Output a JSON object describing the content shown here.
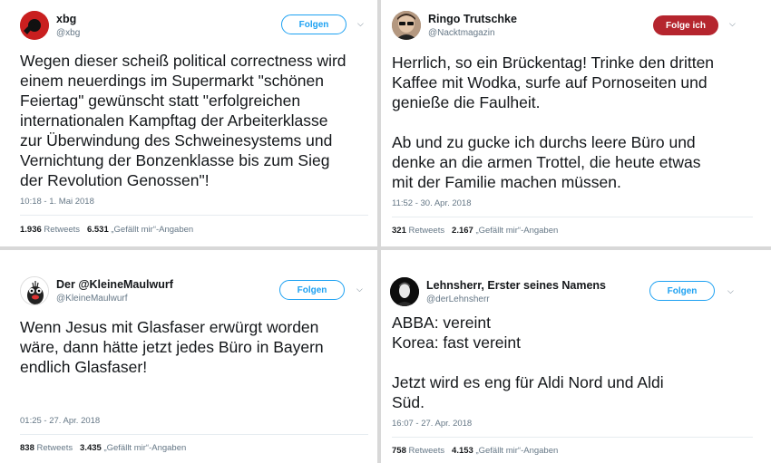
{
  "tweets": [
    {
      "name": "xbg",
      "handle": "@xbg",
      "follow": "Folgen",
      "text": [
        "Wegen dieser scheiß political correctness wird",
        "einem neuerdings im Supermarkt \"schönen",
        "Feiertag\" gewünscht statt \"erfolgreichen",
        "internationalen Kampftag der Arbeiterklasse",
        "zur Überwindung des Schweinesystems  und",
        "Vernichtung der Bonzenklasse bis zum Sieg",
        "der Revolution Genossen\"!"
      ],
      "time": "10:18 - 1. Mai 2018",
      "retweets": "1.936",
      "retweets_label": "Retweets",
      "likes": "6.531",
      "likes_label": "„Gefällt mir“-Angaben"
    },
    {
      "name": "Ringo Trutschke",
      "handle": "@Nacktmagazin",
      "follow": "Folge ich",
      "text1": [
        "Herrlich, so ein Brückentag! Trinke den dritten",
        "Kaffee mit Wodka, surfe auf Pornoseiten und",
        "genieße die Faulheit."
      ],
      "text2": [
        "Ab und zu gucke ich durchs leere Büro und",
        "denke an die armen Trottel, die heute etwas",
        "mit der Familie machen müssen."
      ],
      "time": "11:52 - 30. Apr. 2018",
      "retweets": "321",
      "retweets_label": "Retweets",
      "likes": "2.167",
      "likes_label": "„Gefällt mir“-Angaben"
    },
    {
      "name": "Der @KleineMaulwurf",
      "handle": "@KleineMaulwurf",
      "follow": "Folgen",
      "text": [
        "Wenn Jesus mit Glasfaser erwürgt worden",
        "wäre, dann hätte jetzt jedes Büro in Bayern",
        "endlich Glasfaser!"
      ],
      "time": "01:25 - 27. Apr. 2018",
      "retweets": "838",
      "retweets_label": "Retweets",
      "likes": "3.435",
      "likes_label": "„Gefällt mir“-Angaben"
    },
    {
      "name": "Lehnsherr, Erster seines Namens",
      "handle": "@derLehnsherr",
      "follow": "Folgen",
      "text1": [
        "ABBA: vereint",
        "Korea: fast vereint"
      ],
      "text2": [
        "Jetzt wird es eng für Aldi Nord und Aldi",
        "Süd."
      ],
      "time": "16:07 - 27. Apr. 2018",
      "retweets": "758",
      "retweets_label": "Retweets",
      "likes": "4.153",
      "likes_label": "„Gefällt mir“-Angaben"
    }
  ],
  "colors": {
    "link_blue": "#1da1f2",
    "following_red": "#b5252e",
    "muted": "#657786"
  },
  "icons": [
    "avatar-xbg",
    "avatar-ringo",
    "avatar-maulwurf",
    "avatar-lehnsherr",
    "chevron-down-icon"
  ]
}
